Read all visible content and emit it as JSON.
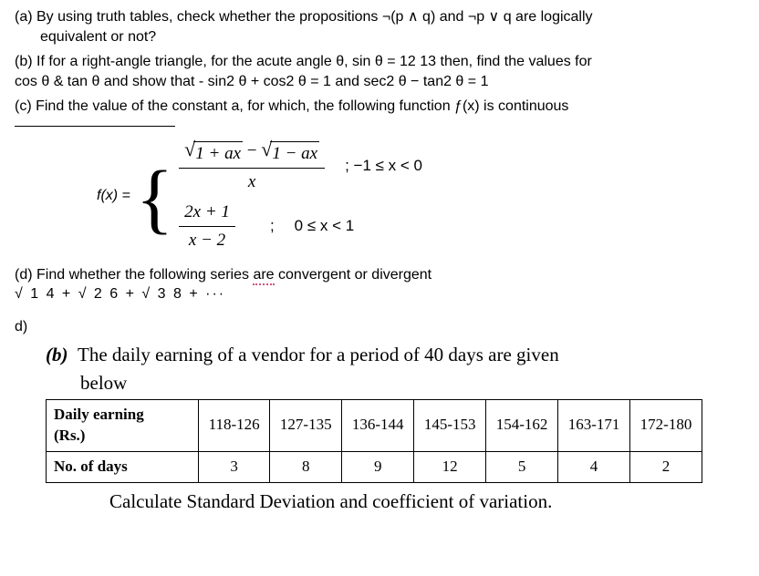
{
  "a": {
    "line1": "(a) By using truth tables, check whether the propositions ¬(p ∧ q) and ¬p ∨ q are logically",
    "line2": "equivalent or not?"
  },
  "b": {
    "line1": "(b) If for a right-angle triangle, for the acute angle θ, sin θ = 12 13 then, find the values for",
    "line2": "cos θ & tan θ and show that - sin2 θ + cos2 θ = 1 and sec2 θ − tan2 θ = 1"
  },
  "c": {
    "text": "(c) Find the value of the constant a, for which, the following function ƒ(x) is continuous",
    "fx": "f(x) =",
    "num1_a": "1 + ax",
    "num1_mid": " − ",
    "num1_b": "1 − ax",
    "den1": "x",
    "cond1": "; −1 ≤ x < 0",
    "num2": "2x + 1",
    "den2": "x − 2",
    "cond2_semi": ";",
    "cond2": "0 ≤ x < 1"
  },
  "d1": {
    "line1a": "(d) Find whether the following series ",
    "line1b": "are",
    "line1c": " convergent or divergent",
    "series": "√ 1 4 + √ 2 6 + √ 3 8 + ···"
  },
  "d2": {
    "label": "d)",
    "b_label": "(b)",
    "b_text1": "The daily earning of a vendor for a period of 40 days are given",
    "b_text2": "below",
    "row1_label": "Daily earning",
    "row1_sub": "(Rs.)",
    "row2_label": "No. of days",
    "headers": [
      "118-126",
      "127-135",
      "136-144",
      "145-153",
      "154-162",
      "163-171",
      "172-180"
    ],
    "values": [
      "3",
      "8",
      "9",
      "12",
      "5",
      "4",
      "2"
    ],
    "calc": "Calculate Standard Deviation and coefficient of variation."
  }
}
